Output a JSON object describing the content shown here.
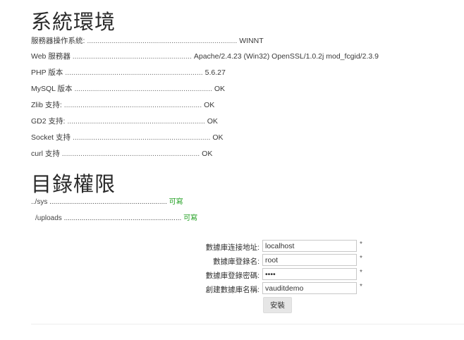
{
  "sections": {
    "environment_title": "系統環境",
    "permissions_title": "目錄權限"
  },
  "environment": [
    {
      "label": "服務器操作系統:",
      "dots": ".........................................................................",
      "value": "WINNT"
    },
    {
      "label": "Web 服務器",
      "dots": "..........................................................",
      "value": "Apache/2.4.23 (Win32) OpenSSL/1.0.2j mod_fcgid/2.3.9"
    },
    {
      "label": "PHP 版本",
      "dots": "...................................................................",
      "value": "5.6.27"
    },
    {
      "label": "MySQL 版本",
      "dots": "...................................................................",
      "value": "OK"
    },
    {
      "label": "Zlib 支持:",
      "dots": "...................................................................",
      "value": "OK"
    },
    {
      "label": "GD2 支持:",
      "dots": "...................................................................",
      "value": "OK"
    },
    {
      "label": "Socket 支持",
      "dots": "...................................................................",
      "value": "OK"
    },
    {
      "label": "curl 支持",
      "dots": "...................................................................",
      "value": "OK"
    }
  ],
  "permissions": [
    {
      "path": "../sys",
      "dots": "............................................................",
      "status": "可寫"
    },
    {
      "path": "/uploads",
      "dots": "............................................................",
      "status": "可寫"
    }
  ],
  "form": {
    "fields": [
      {
        "label": "數據庫连接地址:",
        "value": "localhost",
        "required": "*"
      },
      {
        "label": "數據庫登錄名:",
        "value": "root",
        "required": "*"
      },
      {
        "label": "數據庫登錄密碼:",
        "value": "••••",
        "required": "*"
      },
      {
        "label": "創建數據庫名稱:",
        "value": "vauditdemo",
        "required": "*"
      }
    ],
    "install_label": "安裝"
  },
  "colors": {
    "ok_green": "#22a022",
    "button_bg": "#e6e6e6",
    "input_border": "#c8c8c8"
  }
}
